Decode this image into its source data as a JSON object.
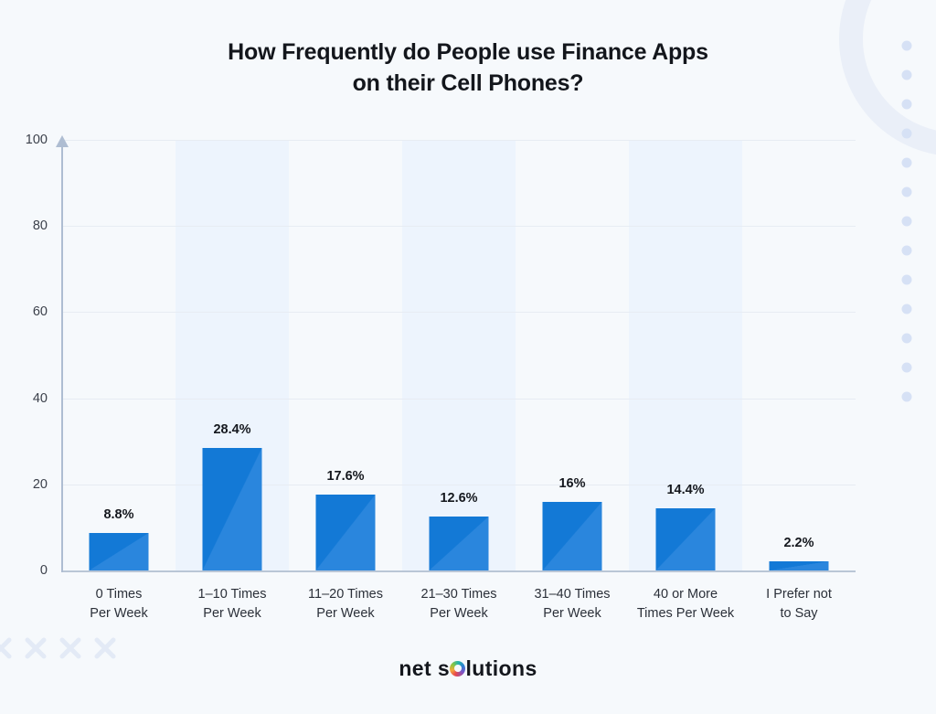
{
  "chart_data": {
    "type": "bar",
    "title": "How Frequently do People use Finance Apps on their Cell Phones?",
    "title_lines": [
      "How Frequently do People use Finance Apps",
      "on their Cell Phones?"
    ],
    "xlabel": "",
    "ylabel": "",
    "ylim": [
      0,
      100
    ],
    "yticks": [
      0,
      20,
      40,
      60,
      80,
      100
    ],
    "ytick_labels": [
      "0",
      "20",
      "40",
      "60",
      "80",
      "100"
    ],
    "grid": true,
    "legend": null,
    "bar_color": "#1379d6",
    "bar_color_light": "#2a86dd",
    "band_color": "#eaf2fd",
    "background_color": "#f6f9fc",
    "categories": [
      "0 Times Per Week",
      "1–10 Times Per Week",
      "11–20 Times Per Week",
      "21–30 Times Per Week",
      "31–40 Times Per Week",
      "40 or More Times Per Week",
      "I Prefer not to Say"
    ],
    "category_lines": [
      [
        "0 Times",
        "Per Week"
      ],
      [
        "1–10 Times",
        "Per Week"
      ],
      [
        "11–20 Times",
        "Per Week"
      ],
      [
        "21–30 Times",
        "Per Week"
      ],
      [
        "31–40 Times",
        "Per Week"
      ],
      [
        "40 or More",
        "Times Per Week"
      ],
      [
        "I Prefer not",
        "to Say"
      ]
    ],
    "values": [
      8.8,
      28.4,
      17.6,
      12.6,
      16,
      14.4,
      2.2
    ],
    "value_labels": [
      "8.8%",
      "28.4%",
      "17.6%",
      "12.6%",
      "16%",
      "14.4%",
      "2.2%"
    ],
    "highlighted_columns": [
      1,
      3,
      5
    ]
  },
  "brand": {
    "text_before": "net s",
    "text_after": "lutions",
    "full": "net solutions"
  }
}
